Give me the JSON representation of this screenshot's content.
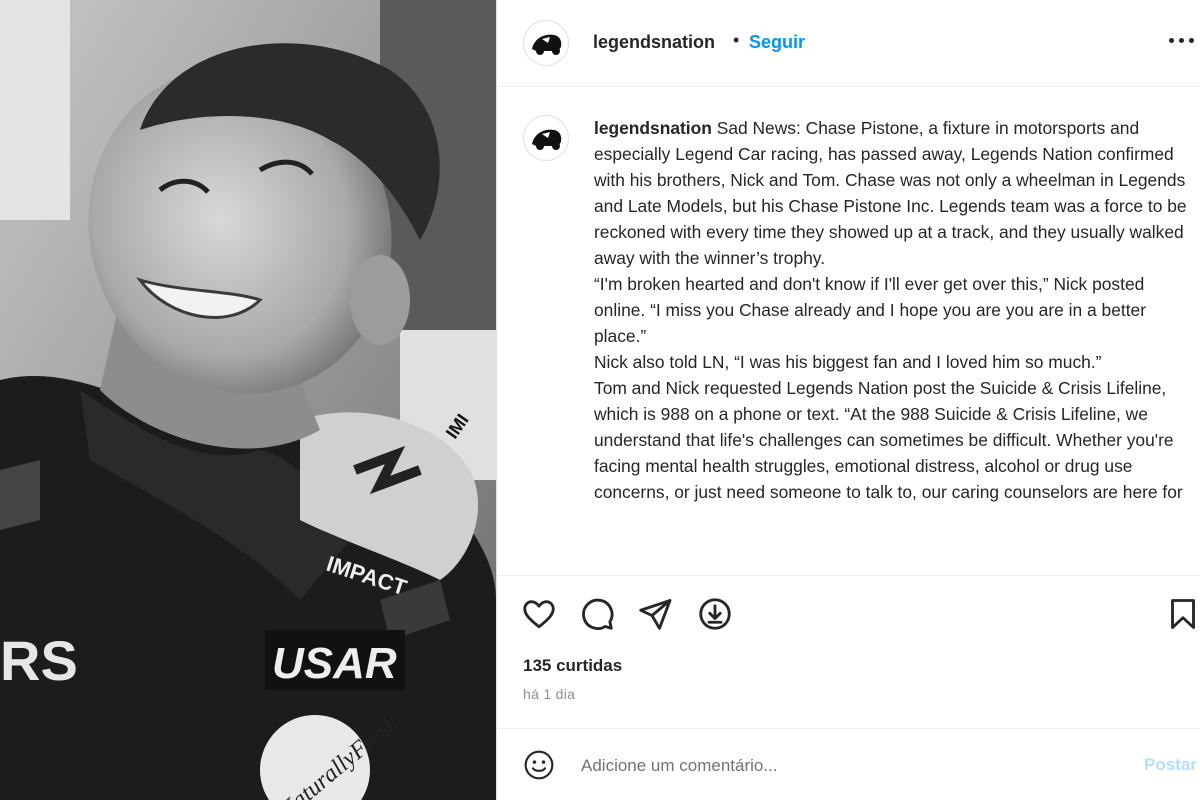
{
  "post": {
    "username": "legendsnation",
    "separator": "•",
    "follow_label": "Seguir",
    "caption": {
      "username": "legendsnation",
      "paragraphs": [
        " Sad News: Chase Pistone, a fixture in motorsports and especially Legend Car racing, has passed away, Legends Nation confirmed with his brothers, Nick and Tom. Chase was not only a wheelman in Legends and Late Models, but his Chase Pistone Inc. Legends team was a force to be reckoned with every time they showed up at a track, and they usually walked away with the winner’s trophy.",
        "“I'm broken hearted and don't know if I'll ever get over this,” Nick posted online. “I miss you Chase already and I hope you are you are in a better place.”",
        "Nick also told LN, “I was his biggest fan and I loved him so much.”",
        "Tom and Nick requested Legends Nation post the Suicide & Crisis Lifeline, which is 988 on a phone or text. “At the 988 Suicide & Crisis Lifeline, we understand that life's challenges can sometimes be difficult. Whether you're facing mental health struggles, emotional distress, alcohol or drug use concerns, or just need someone to talk to, our caring counselors are here for"
      ]
    },
    "likes_text": "135 curtidas",
    "time_text": "há 1 dia",
    "comment_placeholder": "Adicione um comentário...",
    "post_label": "Postar"
  },
  "photo": {
    "jersey_text_1": "IMPACT",
    "jersey_text_2": "USAR",
    "jersey_text_3": "NaturallyFresh",
    "jersey_text_4": "RS",
    "jersey_text_5": "IMI"
  },
  "icons": {
    "avatar": "legendsnation-logo-icon",
    "more": "more-options-icon",
    "like": "heart-icon",
    "comment": "comment-icon",
    "share": "share-icon",
    "download": "download-icon",
    "save": "bookmark-icon",
    "emoji": "emoji-icon"
  },
  "colors": {
    "link_blue": "#0095f6",
    "post_button_disabled": "#b2dffc",
    "muted_text": "#8e8e8e",
    "text": "#262626"
  }
}
